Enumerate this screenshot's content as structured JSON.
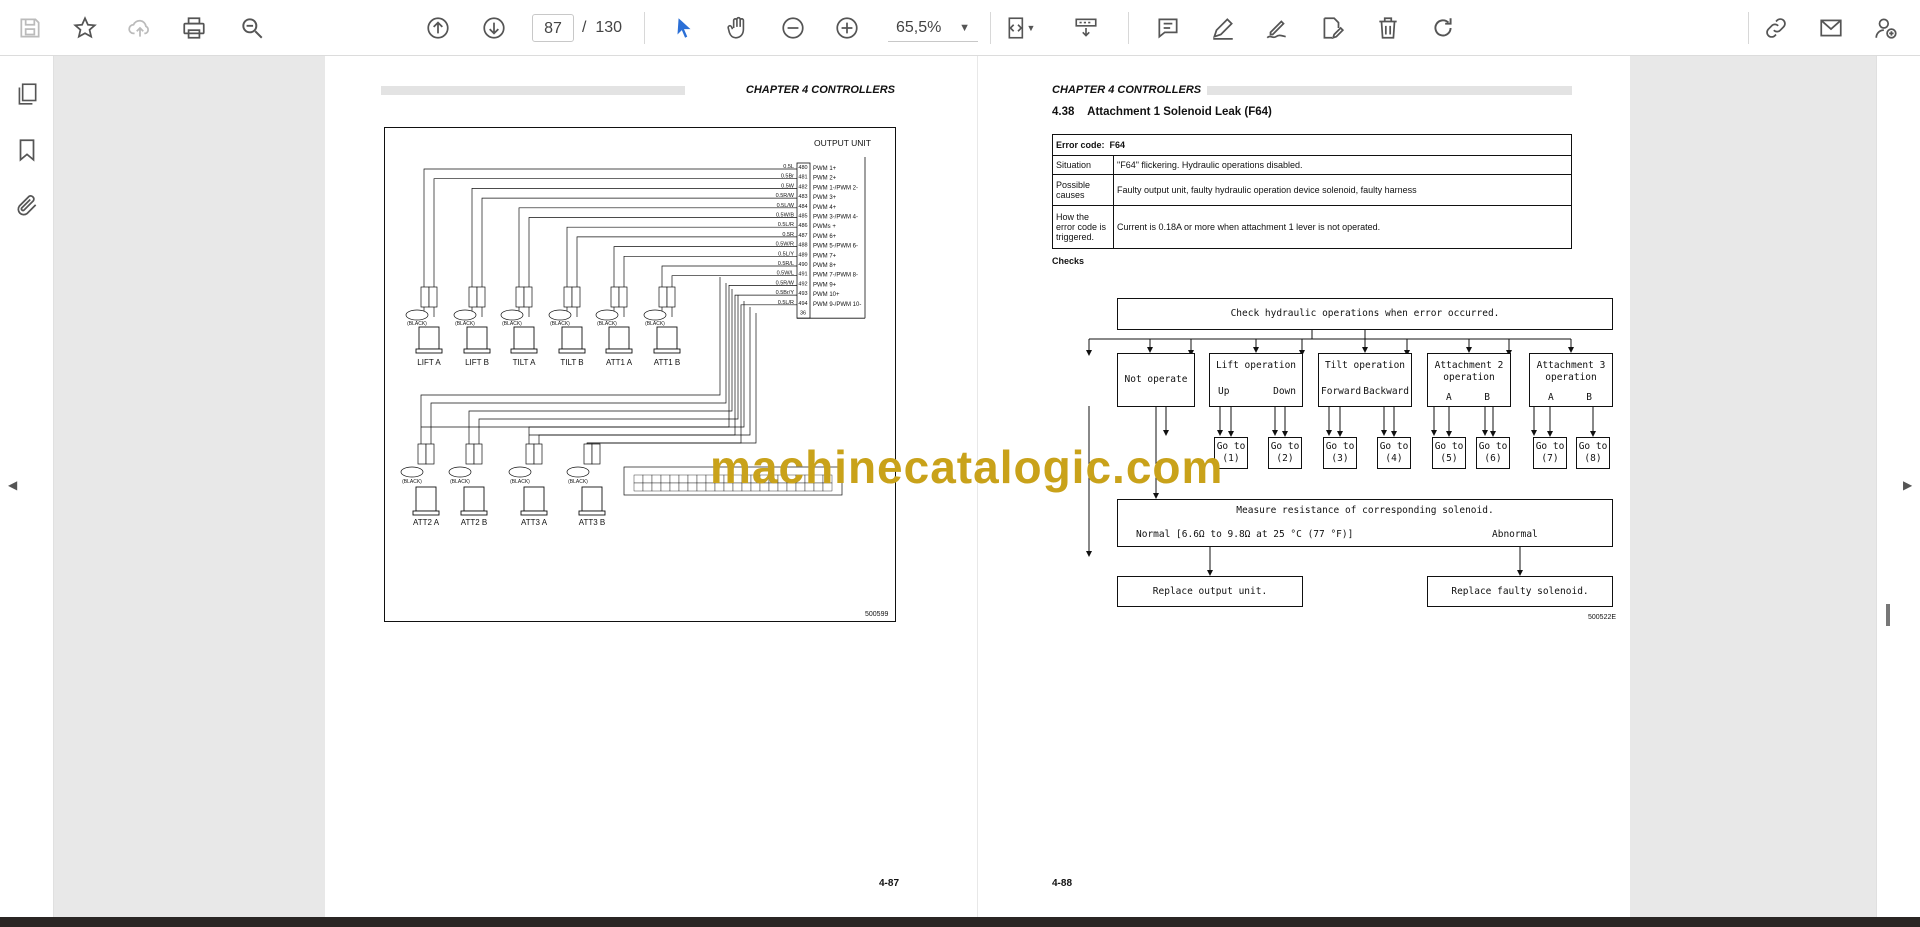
{
  "toolbar": {
    "icons": [
      "save-icon",
      "bookmark-star-icon",
      "upload-icon",
      "print-icon",
      "zoom-search-icon",
      "page-up-icon",
      "page-down-icon",
      "select-arrow-icon",
      "hand-icon",
      "zoom-out-icon",
      "zoom-in-icon",
      "page-fit-icon",
      "scan-icon",
      "comment-icon",
      "pen-icon",
      "sign-icon",
      "edit-page-icon",
      "delete-icon",
      "redo-icon",
      "share-link-icon",
      "mail-icon",
      "add-user-icon"
    ],
    "current_page": "87",
    "page_separator": "/",
    "total_pages": "130",
    "zoom": "65,5%"
  },
  "left_page": {
    "chapter": "CHAPTER 4  CONTROLLERS",
    "page_number": "4-87",
    "figure_code": "500599",
    "output_unit_title": "OUTPUT UNIT",
    "wires": [
      {
        "color": "0.5L",
        "pin": "480",
        "signal": "PWM 1+"
      },
      {
        "color": "0.5Br",
        "pin": "481",
        "signal": "PWM 2+"
      },
      {
        "color": "0.5W",
        "pin": "482",
        "signal": "PWM 1-/PWM 2-"
      },
      {
        "color": "0.5R/W",
        "pin": "483",
        "signal": "PWM 3+"
      },
      {
        "color": "0.5L/W",
        "pin": "484",
        "signal": "PWM 4+"
      },
      {
        "color": "0.5W/B",
        "pin": "485",
        "signal": "PWM 3-/PWM 4-"
      },
      {
        "color": "0.5L/R",
        "pin": "486",
        "signal": "PWMs +"
      },
      {
        "color": "0.5R",
        "pin": "487",
        "signal": "PWM 6+"
      },
      {
        "color": "0.5W/R",
        "pin": "488",
        "signal": "PWM 5-/PWM 6-"
      },
      {
        "color": "0.5L/Y",
        "pin": "489",
        "signal": "PWM 7+"
      },
      {
        "color": "0.5R/L",
        "pin": "490",
        "signal": "PWM 8+"
      },
      {
        "color": "0.5W/L",
        "pin": "491",
        "signal": "PWM 7-/PWM 8-"
      },
      {
        "color": "0.5R/W",
        "pin": "492",
        "signal": "PWM 9+"
      },
      {
        "color": "0.5Br/Y",
        "pin": "493",
        "signal": "PWM 10+"
      },
      {
        "color": "0.5L/R",
        "pin": "494",
        "signal": "PWM 9-/PWM 10-"
      },
      {
        "color": "",
        "pin": "36",
        "signal": ""
      }
    ],
    "top_solenoids": [
      "LIFT A",
      "LIFT B",
      "TILT A",
      "TILT B",
      "ATT1 A",
      "ATT1 B"
    ],
    "bottom_solenoids": [
      "ATT2 A",
      "ATT2 B",
      "ATT3 A",
      "ATT3 B"
    ],
    "connector_tag": "(BLACK)"
  },
  "right_page": {
    "chapter": "CHAPTER 4  CONTROLLERS",
    "section_number": "4.38",
    "section_title": "Attachment 1 Solenoid Leak (F64)",
    "error_code_label": "Error code:",
    "error_code": "F64",
    "rows": [
      {
        "label": "Situation",
        "value": "\"F64\" flickering. Hydraulic operations disabled."
      },
      {
        "label": "Possible causes",
        "value": "Faulty output unit, faulty hydraulic operation device solenoid, faulty harness"
      },
      {
        "label": "How the error code is triggered.",
        "value": "Current is 0.18A or more when attachment 1 lever is not operated."
      }
    ],
    "checks_label": "Checks",
    "flow": {
      "top": "Check hydraulic operations when error occurred.",
      "not_operate": "Not operate",
      "lift": {
        "title": "Lift operation",
        "a": "Up",
        "b": "Down"
      },
      "tilt": {
        "title": "Tilt operation",
        "a": "Forward",
        "b": "Backward"
      },
      "att2": {
        "title": "Attachment 2 operation",
        "a": "A",
        "b": "B"
      },
      "att3": {
        "title": "Attachment 3 operation",
        "a": "A",
        "b": "B"
      },
      "goto": [
        "Go to (1)",
        "Go to (2)",
        "Go to (3)",
        "Go to (4)",
        "Go to (5)",
        "Go to (6)",
        "Go to (7)",
        "Go to (8)"
      ],
      "measure": "Measure resistance of corresponding solenoid.",
      "normal": "Normal [6.6Ω to 9.8Ω at 25 °C (77 °F)]",
      "abnormal": "Abnormal",
      "replace_output": "Replace output unit.",
      "replace_solenoid": "Replace faulty solenoid."
    },
    "figure_code": "500522E",
    "page_number": "4-88"
  },
  "watermark": "machinecatalogic.com",
  "sidebar": {
    "icons": [
      "pages-thumbnail-icon",
      "bookmark-icon",
      "attachment-clip-icon"
    ]
  }
}
